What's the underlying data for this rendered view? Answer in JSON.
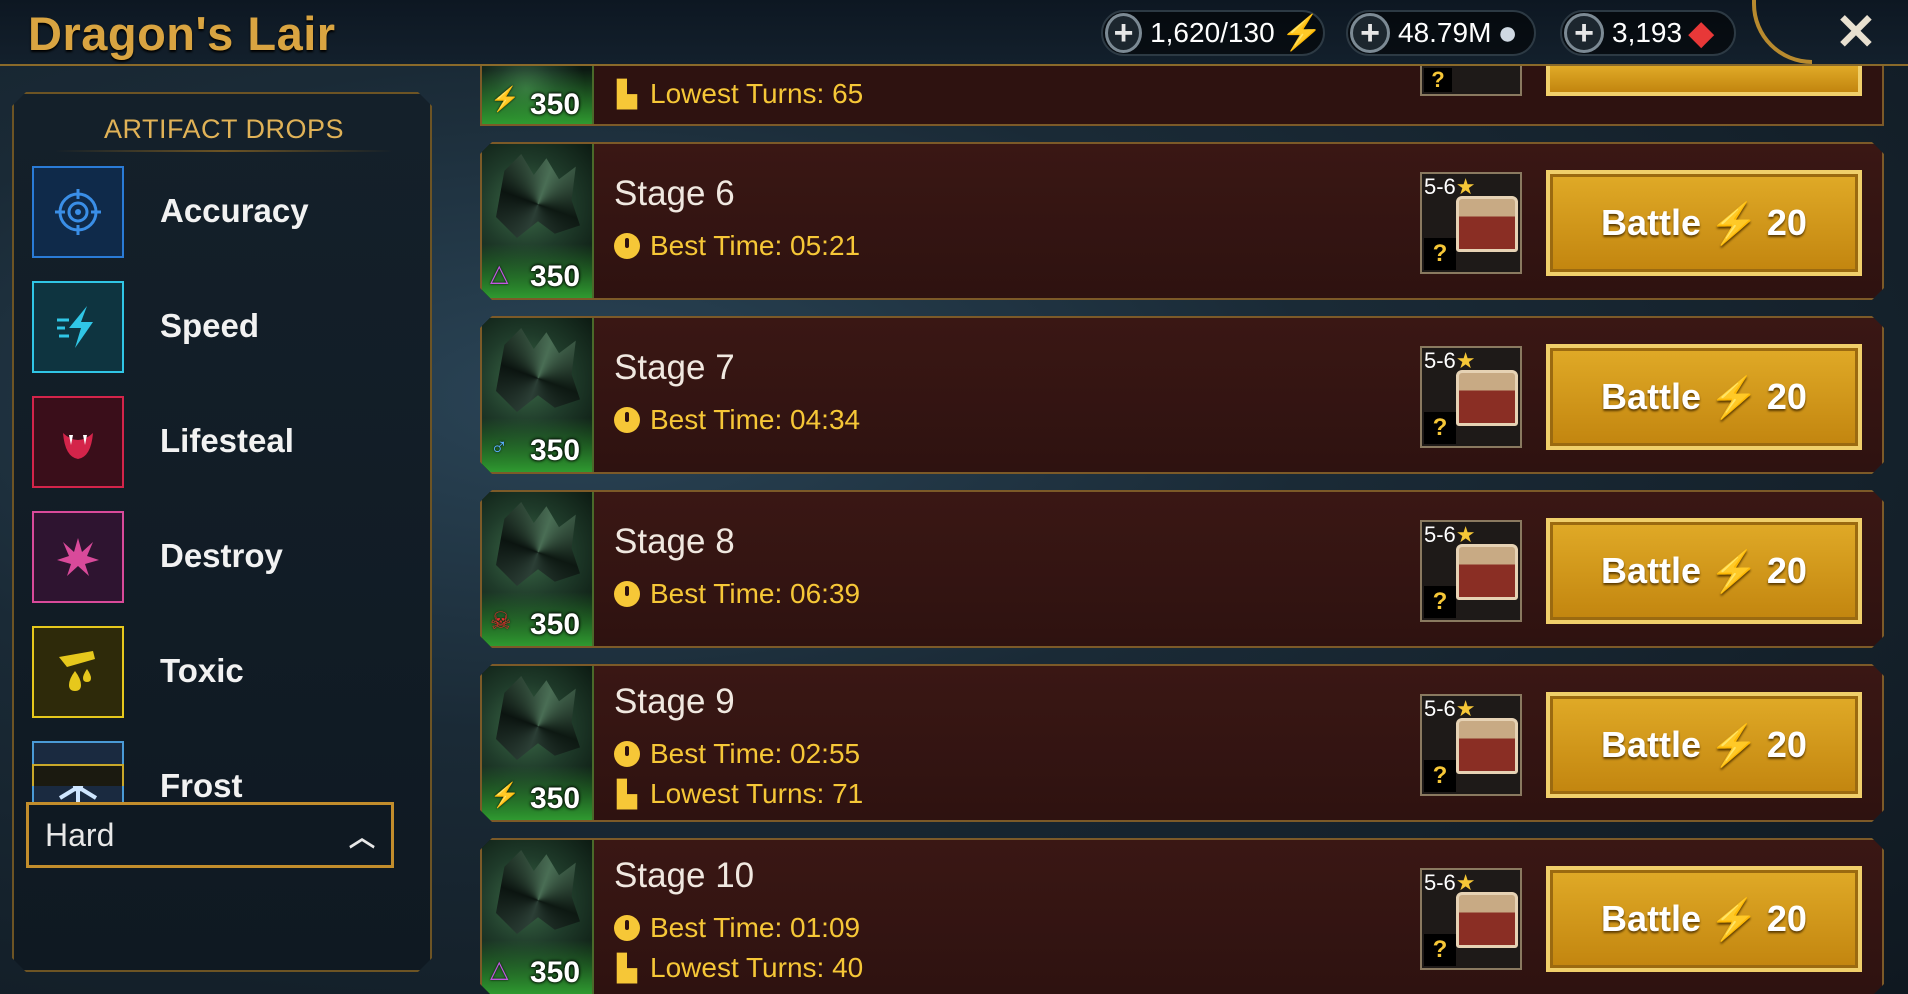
{
  "header": {
    "title": "Dragon's Lair",
    "energy": "1,620/130",
    "silver": "48.79M",
    "gems": "3,193",
    "close_symbol": "✕"
  },
  "artifact_drops": {
    "title": "ARTIFACT DROPS",
    "items": [
      {
        "label": "Accuracy",
        "icon": "accuracy-icon",
        "color": "#2a7bd6"
      },
      {
        "label": "Speed",
        "icon": "speed-icon",
        "color": "#30c6e6"
      },
      {
        "label": "Lifesteal",
        "icon": "lifesteal-icon",
        "color": "#d4244a"
      },
      {
        "label": "Destroy",
        "icon": "destroy-icon",
        "color": "#d94a9a"
      },
      {
        "label": "Toxic",
        "icon": "toxic-icon",
        "color": "#e6c81c"
      },
      {
        "label": "Frost",
        "icon": "frost-icon",
        "color": "#4a9ad6"
      }
    ],
    "difficulty": "Hard"
  },
  "stages": {
    "partial": {
      "level": "350",
      "lowest_turns": "Lowest Turns: 65"
    },
    "rows": [
      {
        "name": "Stage 6",
        "level": "350",
        "best_time": "Best Time: 05:21",
        "lowest_turns": "",
        "stars": "5-6",
        "battle_label": "Battle",
        "cost": "20",
        "affinity": "magic"
      },
      {
        "name": "Stage 7",
        "level": "350",
        "best_time": "Best Time: 04:34",
        "lowest_turns": "",
        "stars": "5-6",
        "battle_label": "Battle",
        "cost": "20",
        "affinity": "spirit"
      },
      {
        "name": "Stage 8",
        "level": "350",
        "best_time": "Best Time: 06:39",
        "lowest_turns": "",
        "stars": "5-6",
        "battle_label": "Battle",
        "cost": "20",
        "affinity": "force"
      },
      {
        "name": "Stage 9",
        "level": "350",
        "best_time": "Best Time: 02:55",
        "lowest_turns": "Lowest Turns: 71",
        "stars": "5-6",
        "battle_label": "Battle",
        "cost": "20",
        "affinity": "void"
      },
      {
        "name": "Stage 10",
        "level": "350",
        "best_time": "Best Time: 01:09",
        "lowest_turns": "Lowest Turns: 40",
        "stars": "5-6",
        "battle_label": "Battle",
        "cost": "20",
        "affinity": "magic"
      }
    ]
  }
}
